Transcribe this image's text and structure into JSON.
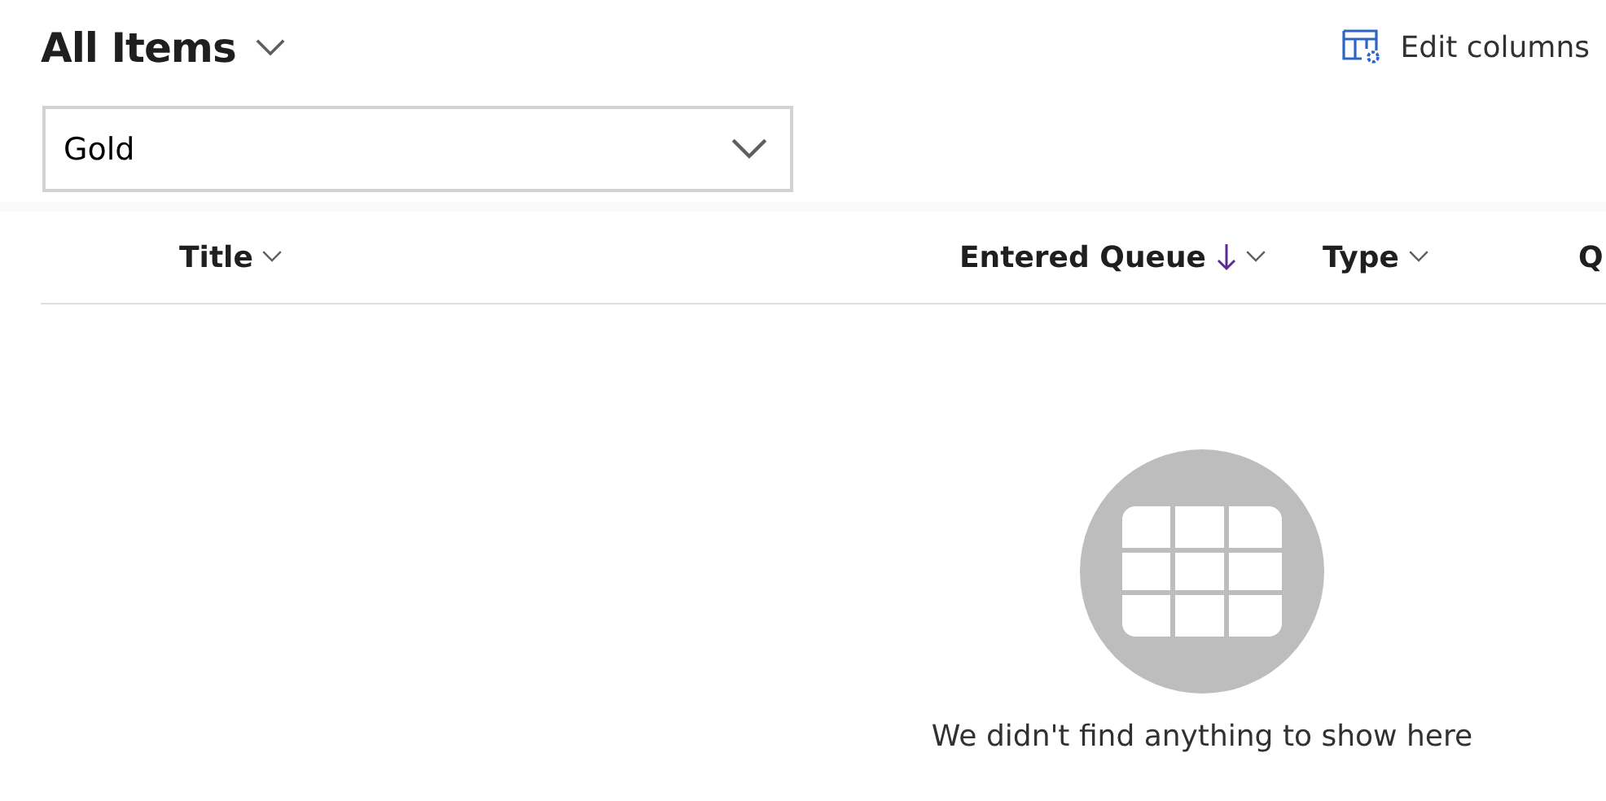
{
  "view": {
    "title": "All Items"
  },
  "edit_columns": {
    "label": "Edit columns"
  },
  "filter": {
    "value": "Gold"
  },
  "columns": [
    {
      "label": "Title",
      "sorted": false
    },
    {
      "label": "Entered Queue",
      "sorted": true
    },
    {
      "label": "Type",
      "sorted": false
    },
    {
      "label": "Q",
      "sorted": false
    }
  ],
  "empty_state": {
    "message": "We didn't find anything to show here"
  }
}
